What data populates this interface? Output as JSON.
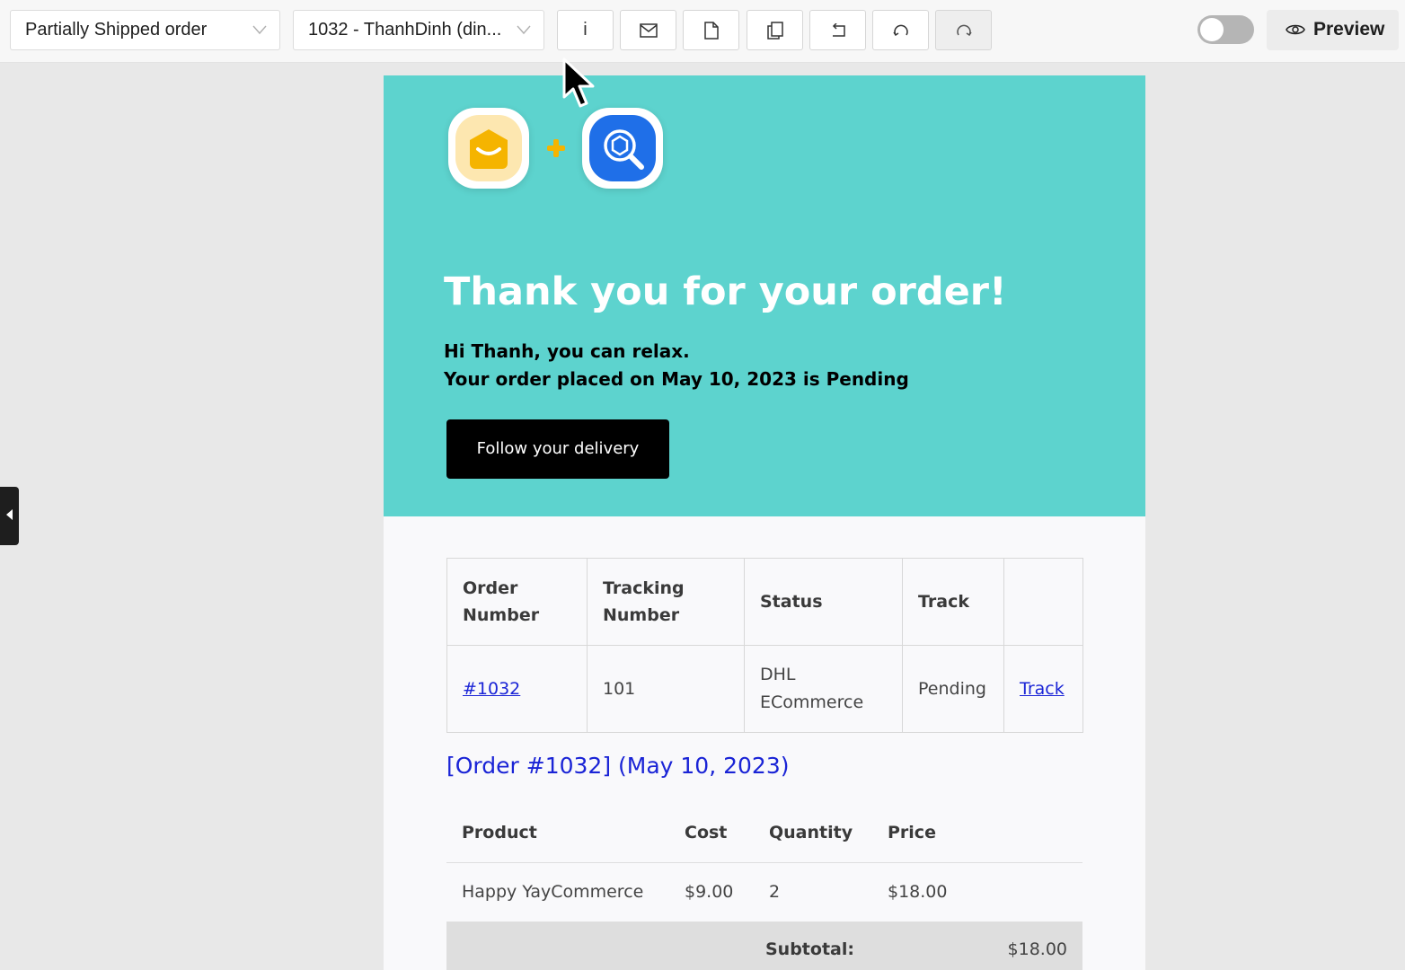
{
  "toolbar": {
    "email_type_select": "Partially Shipped order",
    "order_select": "1032 - ThanhDinh (din...",
    "info_label": "i",
    "preview_label": "Preview"
  },
  "icons": {
    "info": "info-icon",
    "email": "envelope-icon",
    "file": "document-icon",
    "copy": "copy-icon",
    "undo": "undo-icon",
    "reset": "reset-icon",
    "redo": "redo-icon",
    "preview": "eye-icon",
    "collapse": "triangle-left-icon"
  },
  "colors": {
    "hero_bg": "#5dd3ce",
    "link": "#1a24d6",
    "button_bg": "#000000"
  },
  "hero": {
    "title": "Thank you for your order!",
    "line1": "Hi Thanh, you can relax.",
    "line2": "Your order placed on May 10, 2023 is Pending",
    "button_label": "Follow your delivery"
  },
  "tracking_table": {
    "headers": [
      "Order Number",
      "Tracking Number",
      "Status",
      "Track",
      ""
    ],
    "row": {
      "order_number": "#1032",
      "tracking_number": "101",
      "status": "DHL ECommerce",
      "track": "Pending",
      "link": "Track"
    }
  },
  "order_heading": "[Order #1032] (May 10, 2023)",
  "products_table": {
    "headers": [
      "Product",
      "Cost",
      "Quantity",
      "Price"
    ],
    "rows": [
      {
        "product": "Happy YayCommerce",
        "cost": "$9.00",
        "quantity": "2",
        "price": "$18.00"
      }
    ],
    "subtotal_label": "Subtotal:",
    "subtotal_value": "$18.00"
  }
}
